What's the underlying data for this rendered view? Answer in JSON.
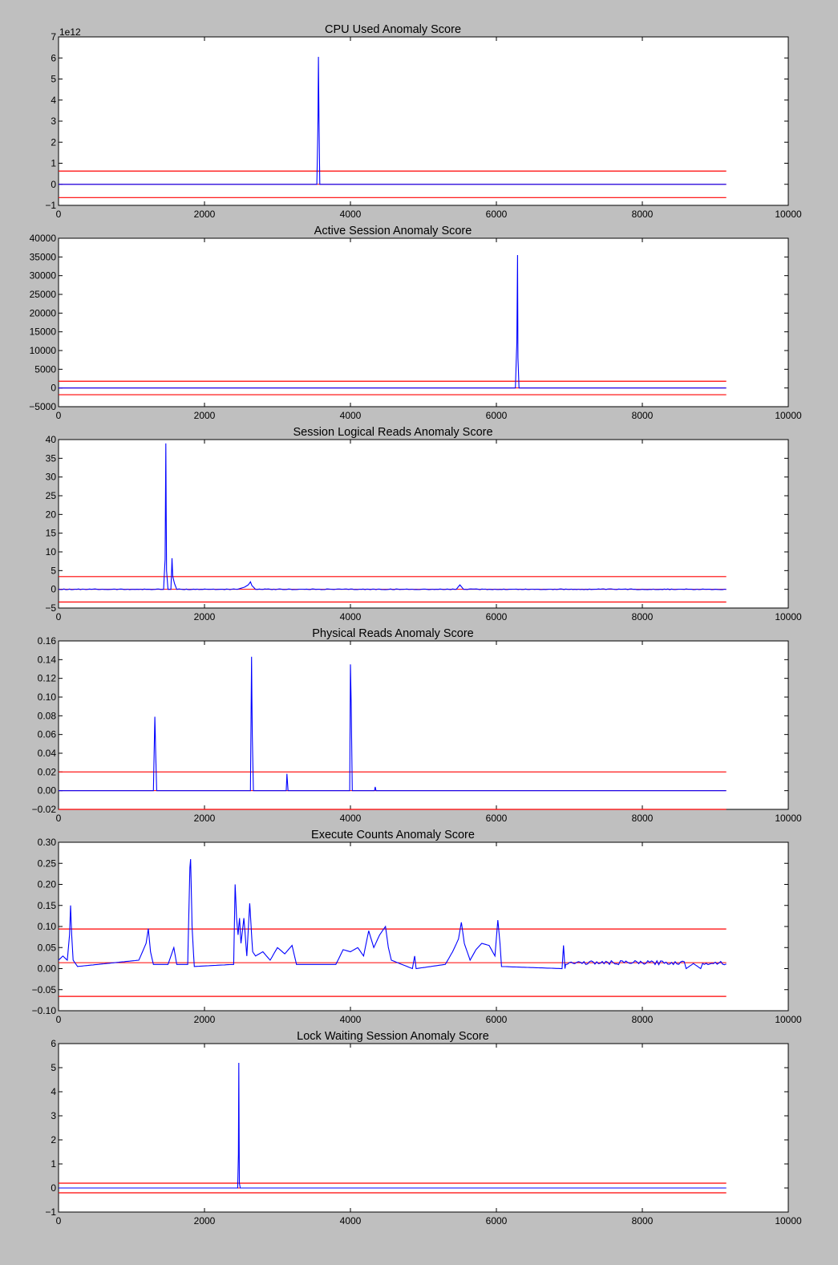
{
  "figure": {
    "background": "#bfbfbf",
    "plot_background": "#ffffff"
  },
  "colors": {
    "score_line": "#0000ff",
    "threshold_line": "#ff0000",
    "mean_line": "#3f007f"
  },
  "chart_data": [
    {
      "type": "line",
      "title": "CPU Used Anomaly Score",
      "offset_text": "1e12",
      "xlim": [
        0,
        10000
      ],
      "ylim": [
        -1,
        7
      ],
      "xticks": [
        0,
        2000,
        4000,
        6000,
        8000,
        10000
      ],
      "xtick_labels": [
        "0",
        "2000",
        "4000",
        "6000",
        "8000",
        "10000"
      ],
      "yticks": [
        -1,
        0,
        1,
        2,
        3,
        4,
        5,
        6,
        7
      ],
      "ytick_labels": [
        "−1",
        "0",
        "1",
        "2",
        "3",
        "4",
        "5",
        "6",
        "7"
      ],
      "x_end": 9150,
      "baseline": 0,
      "thresholds": [
        0.63,
        -0.63
      ],
      "spikes": [
        [
          3540,
          0
        ],
        [
          3555,
          3.0
        ],
        [
          3562,
          6.05
        ],
        [
          3568,
          3.5
        ],
        [
          3580,
          0
        ]
      ],
      "noise": null
    },
    {
      "type": "line",
      "title": "Active Session Anomaly Score",
      "offset_text": "",
      "xlim": [
        0,
        10000
      ],
      "ylim": [
        -5000,
        40000
      ],
      "xticks": [
        0,
        2000,
        4000,
        6000,
        8000,
        10000
      ],
      "xtick_labels": [
        "0",
        "2000",
        "4000",
        "6000",
        "8000",
        "10000"
      ],
      "yticks": [
        -5000,
        0,
        5000,
        10000,
        15000,
        20000,
        25000,
        30000,
        35000,
        40000
      ],
      "ytick_labels": [
        "−5000",
        "0",
        "5000",
        "10000",
        "15000",
        "20000",
        "25000",
        "30000",
        "35000",
        "40000"
      ],
      "x_end": 9150,
      "baseline": 0,
      "thresholds": [
        1800,
        -1800
      ],
      "spikes": [
        [
          6260,
          0
        ],
        [
          6280,
          12000
        ],
        [
          6290,
          35500
        ],
        [
          6296,
          8000
        ],
        [
          6310,
          0
        ]
      ],
      "noise": null
    },
    {
      "type": "line",
      "title": "Session Logical Reads Anomaly Score",
      "offset_text": "",
      "xlim": [
        0,
        10000
      ],
      "ylim": [
        -5,
        40
      ],
      "xticks": [
        0,
        2000,
        4000,
        6000,
        8000,
        10000
      ],
      "xtick_labels": [
        "0",
        "2000",
        "4000",
        "6000",
        "8000",
        "10000"
      ],
      "yticks": [
        -5,
        0,
        5,
        10,
        15,
        20,
        25,
        30,
        35,
        40
      ],
      "ytick_labels": [
        "−5",
        "0",
        "5",
        "10",
        "15",
        "20",
        "25",
        "30",
        "35",
        "40"
      ],
      "x_end": 9150,
      "baseline": 0,
      "thresholds": [
        3.4,
        -3.4
      ],
      "spikes": [
        [
          1440,
          0
        ],
        [
          1460,
          8
        ],
        [
          1470,
          39
        ],
        [
          1480,
          5
        ],
        [
          1500,
          0
        ],
        [
          1540,
          0
        ],
        [
          1555,
          8.3
        ],
        [
          1565,
          3.5
        ],
        [
          1590,
          1.5
        ],
        [
          1620,
          0
        ],
        [
          2450,
          0
        ],
        [
          2550,
          0.6
        ],
        [
          2600,
          1.2
        ],
        [
          2630,
          2.0
        ],
        [
          2650,
          1.0
        ],
        [
          2700,
          0
        ],
        [
          5450,
          0
        ],
        [
          5500,
          1.2
        ],
        [
          5550,
          0
        ]
      ],
      "noise": {
        "amp": 0.2,
        "ranges": [
          [
            0,
            9150
          ]
        ]
      }
    },
    {
      "type": "line",
      "title": "Physical Reads Anomaly Score",
      "offset_text": "",
      "xlim": [
        0,
        10000
      ],
      "ylim": [
        -0.02,
        0.16
      ],
      "xticks": [
        0,
        2000,
        4000,
        6000,
        8000,
        10000
      ],
      "xtick_labels": [
        "0",
        "2000",
        "4000",
        "6000",
        "8000",
        "10000"
      ],
      "yticks": [
        -0.02,
        0.0,
        0.02,
        0.04,
        0.06,
        0.08,
        0.1,
        0.12,
        0.14,
        0.16
      ],
      "ytick_labels": [
        "−0.02",
        "0.00",
        "0.02",
        "0.04",
        "0.06",
        "0.08",
        "0.10",
        "0.12",
        "0.14",
        "0.16"
      ],
      "x_end": 9150,
      "baseline": 0,
      "thresholds": [
        0.02,
        -0.02
      ],
      "spikes": [
        [
          1300,
          0
        ],
        [
          1310,
          0.04
        ],
        [
          1320,
          0.079
        ],
        [
          1330,
          0.045
        ],
        [
          1345,
          0
        ],
        [
          2630,
          0
        ],
        [
          2645,
          0.143
        ],
        [
          2655,
          0.06
        ],
        [
          2670,
          0
        ],
        [
          3120,
          0
        ],
        [
          3130,
          0.018
        ],
        [
          3145,
          0
        ],
        [
          3990,
          0
        ],
        [
          4000,
          0.135
        ],
        [
          4010,
          0.095
        ],
        [
          4025,
          0
        ],
        [
          4330,
          0
        ],
        [
          4340,
          0.004
        ],
        [
          4350,
          0
        ]
      ],
      "noise": null
    },
    {
      "type": "line",
      "title": "Execute Counts Anomaly Score",
      "offset_text": "",
      "xlim": [
        0,
        10000
      ],
      "ylim": [
        -0.1,
        0.3
      ],
      "xticks": [
        0,
        2000,
        4000,
        6000,
        8000,
        10000
      ],
      "xtick_labels": [
        "0",
        "2000",
        "4000",
        "6000",
        "8000",
        "10000"
      ],
      "yticks": [
        -0.1,
        -0.05,
        0.0,
        0.05,
        0.1,
        0.15,
        0.2,
        0.25,
        0.3
      ],
      "ytick_labels": [
        "−0.10",
        "−0.05",
        "0.00",
        "0.05",
        "0.10",
        "0.15",
        "0.20",
        "0.25",
        "0.30"
      ],
      "x_end": 9150,
      "baseline": 0.014,
      "thresholds": [
        0.094,
        -0.066
      ],
      "spikes": [
        [
          0,
          0.02
        ],
        [
          60,
          0.03
        ],
        [
          120,
          0.02
        ],
        [
          150,
          0.08
        ],
        [
          165,
          0.15
        ],
        [
          180,
          0.08
        ],
        [
          200,
          0.02
        ],
        [
          260,
          0.005
        ],
        [
          1100,
          0.02
        ],
        [
          1200,
          0.06
        ],
        [
          1230,
          0.095
        ],
        [
          1260,
          0.04
        ],
        [
          1300,
          0.01
        ],
        [
          1500,
          0.01
        ],
        [
          1580,
          0.05
        ],
        [
          1620,
          0.01
        ],
        [
          1770,
          0.01
        ],
        [
          1800,
          0.24
        ],
        [
          1810,
          0.26
        ],
        [
          1830,
          0.1
        ],
        [
          1860,
          0.005
        ],
        [
          2400,
          0.01
        ],
        [
          2420,
          0.2
        ],
        [
          2440,
          0.12
        ],
        [
          2460,
          0.08
        ],
        [
          2480,
          0.12
        ],
        [
          2500,
          0.06
        ],
        [
          2540,
          0.12
        ],
        [
          2580,
          0.03
        ],
        [
          2620,
          0.155
        ],
        [
          2660,
          0.04
        ],
        [
          2700,
          0.03
        ],
        [
          2800,
          0.04
        ],
        [
          2900,
          0.02
        ],
        [
          3000,
          0.05
        ],
        [
          3100,
          0.035
        ],
        [
          3200,
          0.055
        ],
        [
          3260,
          0.01
        ],
        [
          3800,
          0.01
        ],
        [
          3900,
          0.045
        ],
        [
          4000,
          0.04
        ],
        [
          4100,
          0.05
        ],
        [
          4180,
          0.03
        ],
        [
          4250,
          0.09
        ],
        [
          4320,
          0.05
        ],
        [
          4400,
          0.08
        ],
        [
          4480,
          0.1
        ],
        [
          4520,
          0.05
        ],
        [
          4560,
          0.02
        ],
        [
          4850,
          0.0
        ],
        [
          4880,
          0.03
        ],
        [
          4900,
          0.0
        ],
        [
          5300,
          0.01
        ],
        [
          5400,
          0.04
        ],
        [
          5480,
          0.07
        ],
        [
          5520,
          0.11
        ],
        [
          5560,
          0.06
        ],
        [
          5640,
          0.02
        ],
        [
          5720,
          0.045
        ],
        [
          5800,
          0.06
        ],
        [
          5900,
          0.055
        ],
        [
          5980,
          0.03
        ],
        [
          6020,
          0.115
        ],
        [
          6050,
          0.06
        ],
        [
          6070,
          0.005
        ],
        [
          6900,
          0.0
        ],
        [
          6920,
          0.055
        ],
        [
          6940,
          0.0
        ],
        [
          8600,
          0.0
        ],
        [
          8700,
          0.012
        ],
        [
          8800,
          0.0
        ]
      ],
      "noise": {
        "amp": 0.006,
        "ranges": [
          [
            0,
            9150
          ]
        ]
      }
    },
    {
      "type": "line",
      "title": "Lock Waiting Session Anomaly Score",
      "offset_text": "",
      "xlim": [
        0,
        10000
      ],
      "ylim": [
        -1,
        6
      ],
      "xticks": [
        0,
        2000,
        4000,
        6000,
        8000,
        10000
      ],
      "xtick_labels": [
        "0",
        "2000",
        "4000",
        "6000",
        "8000",
        "10000"
      ],
      "yticks": [
        -1,
        0,
        1,
        2,
        3,
        4,
        5,
        6
      ],
      "ytick_labels": [
        "−1",
        "0",
        "1",
        "2",
        "3",
        "4",
        "5",
        "6"
      ],
      "x_end": 9150,
      "baseline": 0,
      "thresholds": [
        0.2,
        -0.2
      ],
      "spikes": [
        [
          2455,
          0
        ],
        [
          2465,
          1.4
        ],
        [
          2470,
          5.2
        ],
        [
          2478,
          0.2
        ],
        [
          2490,
          0
        ]
      ],
      "noise": null
    }
  ]
}
